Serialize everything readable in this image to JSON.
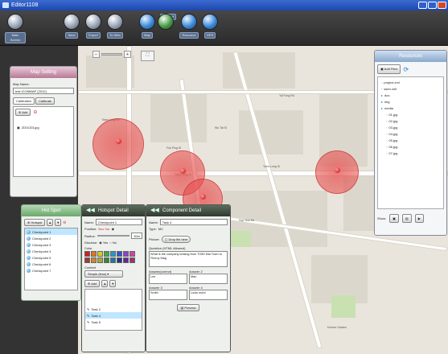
{
  "window": {
    "title": "Editor1108"
  },
  "toolbar": {
    "items": [
      {
        "label": "Main Screen"
      },
      {
        "label": "Save"
      },
      {
        "label": "Export"
      },
      {
        "label": "To Web"
      },
      {
        "label": "Map"
      },
      {
        "label": "Hotspot"
      },
      {
        "label": "Resource"
      },
      {
        "label": "GPS"
      }
    ]
  },
  "map_setting": {
    "title": "Map Setting",
    "map_name_label": "Map Name:",
    "map_name_value": "test ICONMAP (2012)",
    "tabs": [
      "Calibration",
      "Calibrate"
    ],
    "add_label": "Add",
    "file_name": "ZDI1023.jpg"
  },
  "hot_spot": {
    "title": "Hot Spot",
    "add_label": "Hotspot",
    "items": [
      "Checkpoint 1",
      "Checkpoint 2",
      "Checkpoint 3",
      "Checkpoint 4",
      "Checkpoint 5",
      "Checkpoint 6",
      "Checkpoint 7"
    ],
    "selected_index": 0
  },
  "hotspot_detail": {
    "title": "Hotspot Detail",
    "name_label": "Name:",
    "name_value": "Checkpoint 1",
    "position_label": "Position:",
    "position_value": "Bus Sar",
    "radius_label": "Radius:",
    "radius_value": "30m",
    "disclose_label": "Disclose:",
    "yes_label": "Yes",
    "no_label": "No",
    "color_label": "Color",
    "content_label": "Content",
    "content_type": "Simple (less)",
    "add_label": "Add",
    "tasks": [
      "Task 2",
      "Task 4",
      "Task 5"
    ],
    "selected_task_index": 1,
    "colors": [
      "#cc2222",
      "#dd7722",
      "#ddcc22",
      "#44aa44",
      "#2299cc",
      "#3355cc",
      "#8844cc",
      "#cc44aa",
      "#aa3333",
      "#cc8833",
      "#aaaa33",
      "#338833",
      "#227799",
      "#223388",
      "#662299",
      "#993377"
    ]
  },
  "component_detail": {
    "title": "Component Detail",
    "name_label": "Name:",
    "name_value": "Task 4",
    "type_label": "Type:",
    "type_value": "MC",
    "picture_label": "Picture:",
    "picture_button": "Drop file here",
    "question_label": "Question (HTML Allowed)",
    "question_value": "What is the company leasing from TO80 Mai Town to Fitzroy Mag",
    "answer1_label": "Answer(correct)",
    "answer1_value": "Lee",
    "answer2_label": "Answer 2",
    "answer2_value": "Man",
    "answer3_label": "Answer 3",
    "answer3_value": "Smith",
    "answer4_label": "Answer 4",
    "answer4_value": "Louis mont",
    "preview_label": "Preview"
  },
  "resources": {
    "title": "Resources",
    "add_files_label": "Add Files",
    "tree": [
      {
        "label": "project.xml",
        "depth": 0
      },
      {
        "label": "ssen.xml",
        "depth": 0
      },
      {
        "label": "doc",
        "depth": 0
      },
      {
        "label": "img",
        "depth": 0
      },
      {
        "label": "media",
        "depth": 0
      },
      {
        "label": "01.jpg",
        "depth": 1
      },
      {
        "label": "02.jpg",
        "depth": 1
      },
      {
        "label": "03.jpg",
        "depth": 1
      },
      {
        "label": "04.jpg",
        "depth": 1
      },
      {
        "label": "05.jpg",
        "depth": 1
      },
      {
        "label": "06.jpg",
        "depth": 1
      },
      {
        "label": "07.jpg",
        "depth": 1
      }
    ],
    "show_label": "Show:"
  },
  "map": {
    "labels": [
      "Yuen Long Sr",
      "Kam Lung Rd",
      "Tai Fung Rd",
      "Yuen Long St",
      "Fuk Ping St",
      "Wo Tai St",
      "Hop Yick Rd",
      "Hoover Garden"
    ]
  }
}
